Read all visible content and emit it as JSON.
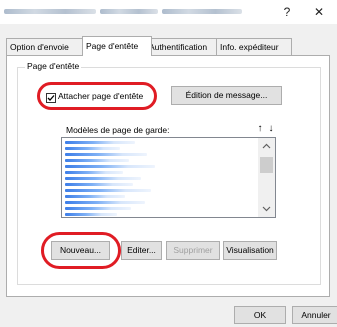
{
  "window": {
    "title": "",
    "help": "?",
    "close": "✕"
  },
  "tabs": [
    {
      "label": "Option d'envoie",
      "active": false
    },
    {
      "label": "Page d'entête",
      "active": true
    },
    {
      "label": "Authentification",
      "active": false
    },
    {
      "label": "Info. expéditeur",
      "active": false
    }
  ],
  "group": {
    "label": "Page d'entête"
  },
  "attach": {
    "label": "Attacher page d'entête",
    "checked": true
  },
  "edit_message_label": "Édition de message...",
  "list": {
    "label": "Modèles de page de garde:",
    "move_up": "↑",
    "move_down": "↓",
    "item_count": 13
  },
  "actions": {
    "new_label": "Nouveau...",
    "edit_label": "Editer...",
    "delete_label": "Supprimer",
    "delete_enabled": false,
    "preview_label": "Visualisation"
  },
  "footer": {
    "ok_label": "OK",
    "cancel_label": "Annuler"
  },
  "colors": {
    "highlight": "#e01c24",
    "selection": "#3d7ee8"
  }
}
